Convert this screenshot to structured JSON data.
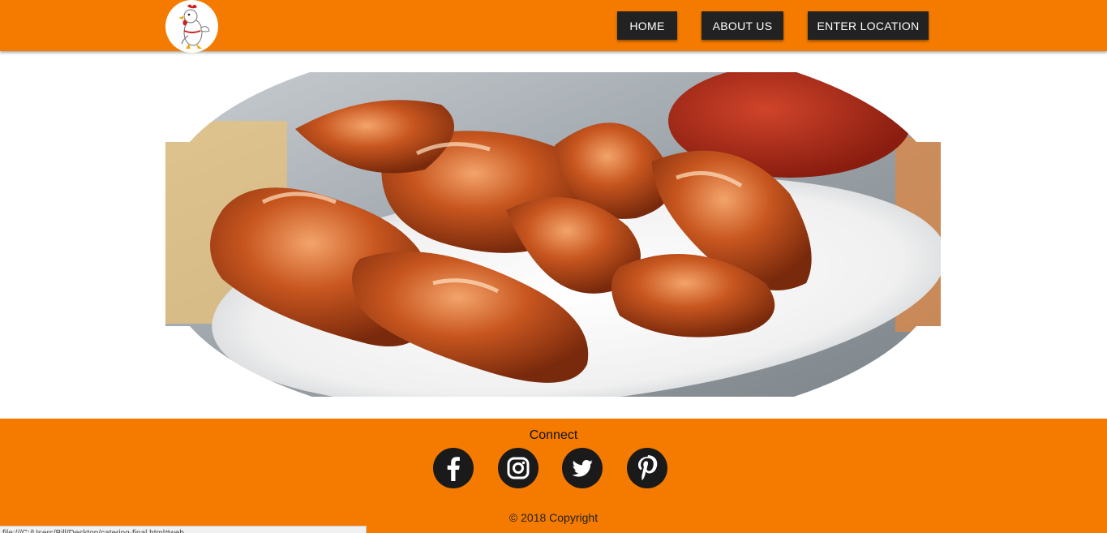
{
  "header": {
    "logo_icon": "chicken-mascot-icon",
    "nav": [
      {
        "label": "HOME"
      },
      {
        "label": "ABOUT US"
      },
      {
        "label": "ENTER LOCATION"
      }
    ]
  },
  "hero": {
    "image": "bbq-chicken-wings-photo"
  },
  "footer": {
    "connect_label": "Connect",
    "social": [
      {
        "icon": "facebook-icon"
      },
      {
        "icon": "instagram-icon"
      },
      {
        "icon": "twitter-icon"
      },
      {
        "icon": "pinterest-icon"
      }
    ],
    "copyright": "© 2018 Copyright"
  },
  "status_bar": {
    "url": "file:///C:/Users/Bill/Desktop/catering-final.html#web"
  },
  "colors": {
    "brand_orange": "#f47b00",
    "nav_button": "#222222",
    "social_icon": "#1a1a1a"
  }
}
